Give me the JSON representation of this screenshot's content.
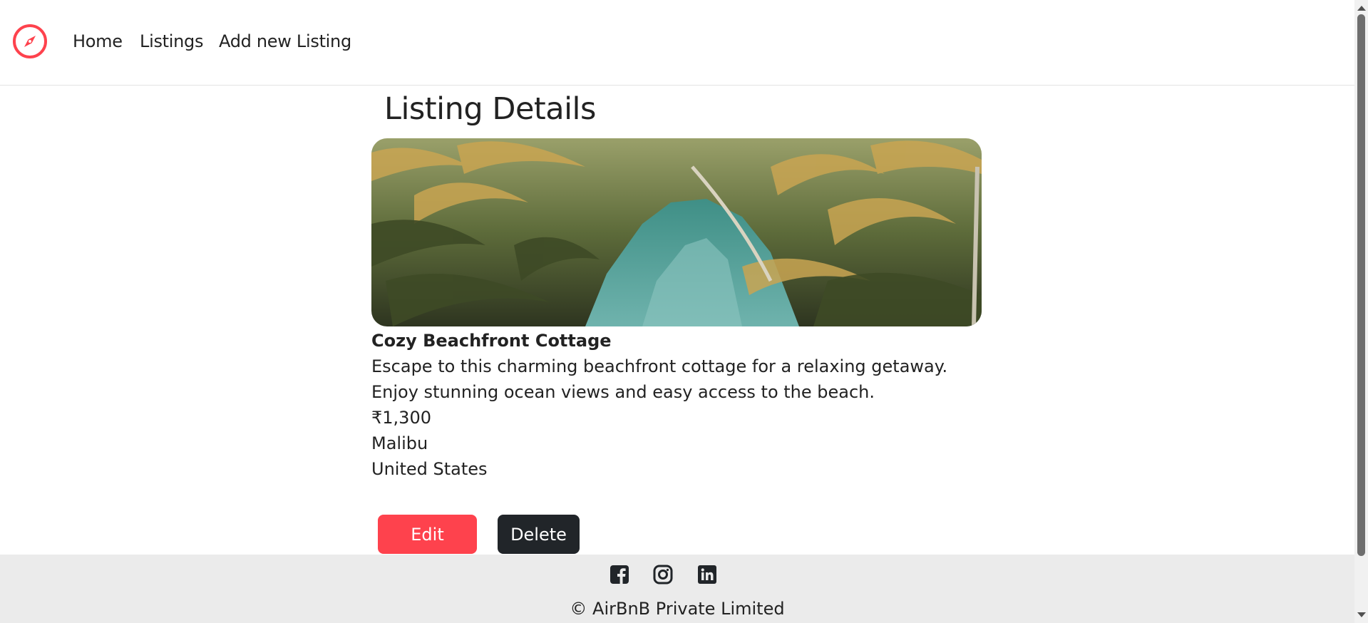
{
  "nav": {
    "logo_icon": "compass-icon",
    "links": [
      "Home",
      "Listings",
      "Add new Listing"
    ]
  },
  "page": {
    "title": "Listing Details"
  },
  "listing": {
    "image_icon": "tropical-lagoon-photo",
    "title": "Cozy Beachfront Cottage",
    "description": "Escape to this charming beachfront cottage for a relaxing getaway. Enjoy stunning ocean views and easy access to the beach.",
    "price": "₹1,300",
    "location": "Malibu",
    "country": "United States"
  },
  "actions": {
    "edit_label": "Edit",
    "delete_label": "Delete"
  },
  "footer": {
    "social_icons": [
      "facebook-icon",
      "instagram-icon",
      "linkedin-icon"
    ],
    "copyright": "© AirBnB Private Limited"
  },
  "colors": {
    "brand": "#fe424d",
    "dark_button": "#212529",
    "footer_bg": "#ebebeb"
  }
}
